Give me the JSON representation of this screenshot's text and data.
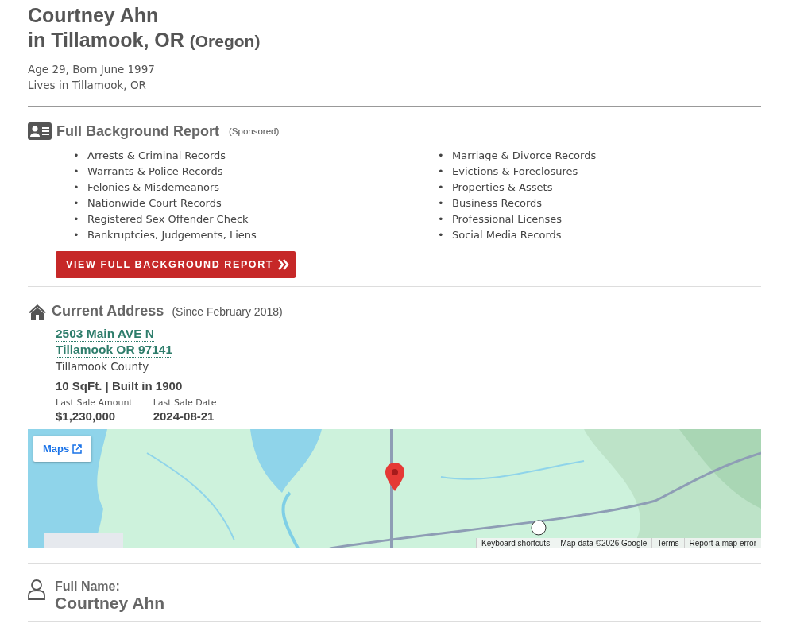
{
  "person": {
    "name": "Courtney Ahn",
    "location": "in Tillamook, OR",
    "state": "(Oregon)",
    "age": "Age 29, Born June 1997",
    "lives": "Lives in Tillamook, OR"
  },
  "report": {
    "title": "Full Background Report",
    "note": "(Sponsored)",
    "bullet": "•",
    "items_left": [
      "Arrests & Criminal Records",
      "Warrants & Police Records",
      "Felonies & Misdemeanors",
      "Nationwide Court Records",
      "Registered Sex Offender Check",
      "Bankruptcies, Judgements, Liens"
    ],
    "items_right": [
      "Marriage & Divorce Records",
      "Evictions & Foreclosures",
      "Properties & Assets",
      "Business Records",
      "Professional Licenses",
      "Social Media Records"
    ],
    "button": "VIEW FULL BACKGROUND REPORT"
  },
  "address": {
    "title": "Current Address",
    "since": "(Since February 2018)",
    "lines": [
      "2503 Main AVE N",
      "Tillamook OR 97141"
    ],
    "county": "Tillamook County",
    "details": "10 SqFt. | Built in 1900",
    "facts": [
      {
        "label": "Last Sale Amount",
        "value": "$1,230,000"
      },
      {
        "label": "Last Sale Date",
        "value": "2024-08-21"
      }
    ]
  },
  "map": {
    "kind": "picture",
    "button": "Maps",
    "attribution": [
      "Keyboard shortcuts",
      "Map data ©2026 Google",
      "Terms",
      "Report a map error"
    ]
  },
  "full_name": {
    "label": "Full Name:",
    "value": "Courtney Ahn"
  }
}
